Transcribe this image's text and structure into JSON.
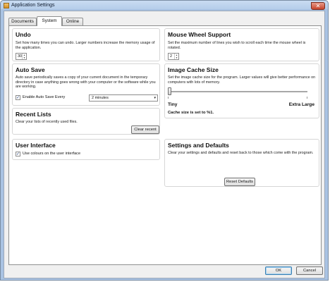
{
  "window": {
    "title": "Application Settings",
    "close_glyph": "✕",
    "app_icon": "app-icon"
  },
  "tabs": [
    {
      "label": "Documents",
      "active": false
    },
    {
      "label": "System",
      "active": true
    },
    {
      "label": "Online",
      "active": false
    }
  ],
  "undo": {
    "title": "Undo",
    "description": "Set how many times you can undo. Larger numbers increase the memory usage of the application.",
    "value": "30"
  },
  "auto_save": {
    "title": "Auto Save",
    "description": "Auto save periodically saves a copy of your current document in the temporary directory in case anything goes wrong with your computer or the software while you are working.",
    "checkbox_label": "Enable Auto Save Every",
    "checked": true,
    "interval_value": "2 minutes"
  },
  "recent_lists": {
    "title": "Recent Lists",
    "description": "Clear your lists of recently used files.",
    "button_label": "Clear recent"
  },
  "user_interface": {
    "title": "User Interface",
    "checkbox_label": "Use colours on the user interface",
    "checked": true
  },
  "mouse_wheel": {
    "title": "Mouse Wheel Support",
    "description": "Set the maximum number of lines you wish to scroll each time the mouse wheel is rotated.",
    "value": "2"
  },
  "image_cache": {
    "title": "Image Cache Size",
    "description": "Set the image cache size for the program. Larger values will give better performance on computers with lots of memory.",
    "min_label": "Tiny",
    "max_label": "Extra Large",
    "status": "Cache size is set to %1.",
    "slider_position": 0.0
  },
  "settings_defaults": {
    "title": "Settings and Defaults",
    "description": "Clear your settings and defaults and reset back to those which come with the program.",
    "button_label": "Reset Defaults"
  },
  "footer": {
    "ok_label": "OK",
    "cancel_label": "Cancel"
  },
  "glyphs": {
    "check": "✓",
    "up": "▲",
    "down": "▼",
    "dropdown": "▾"
  }
}
